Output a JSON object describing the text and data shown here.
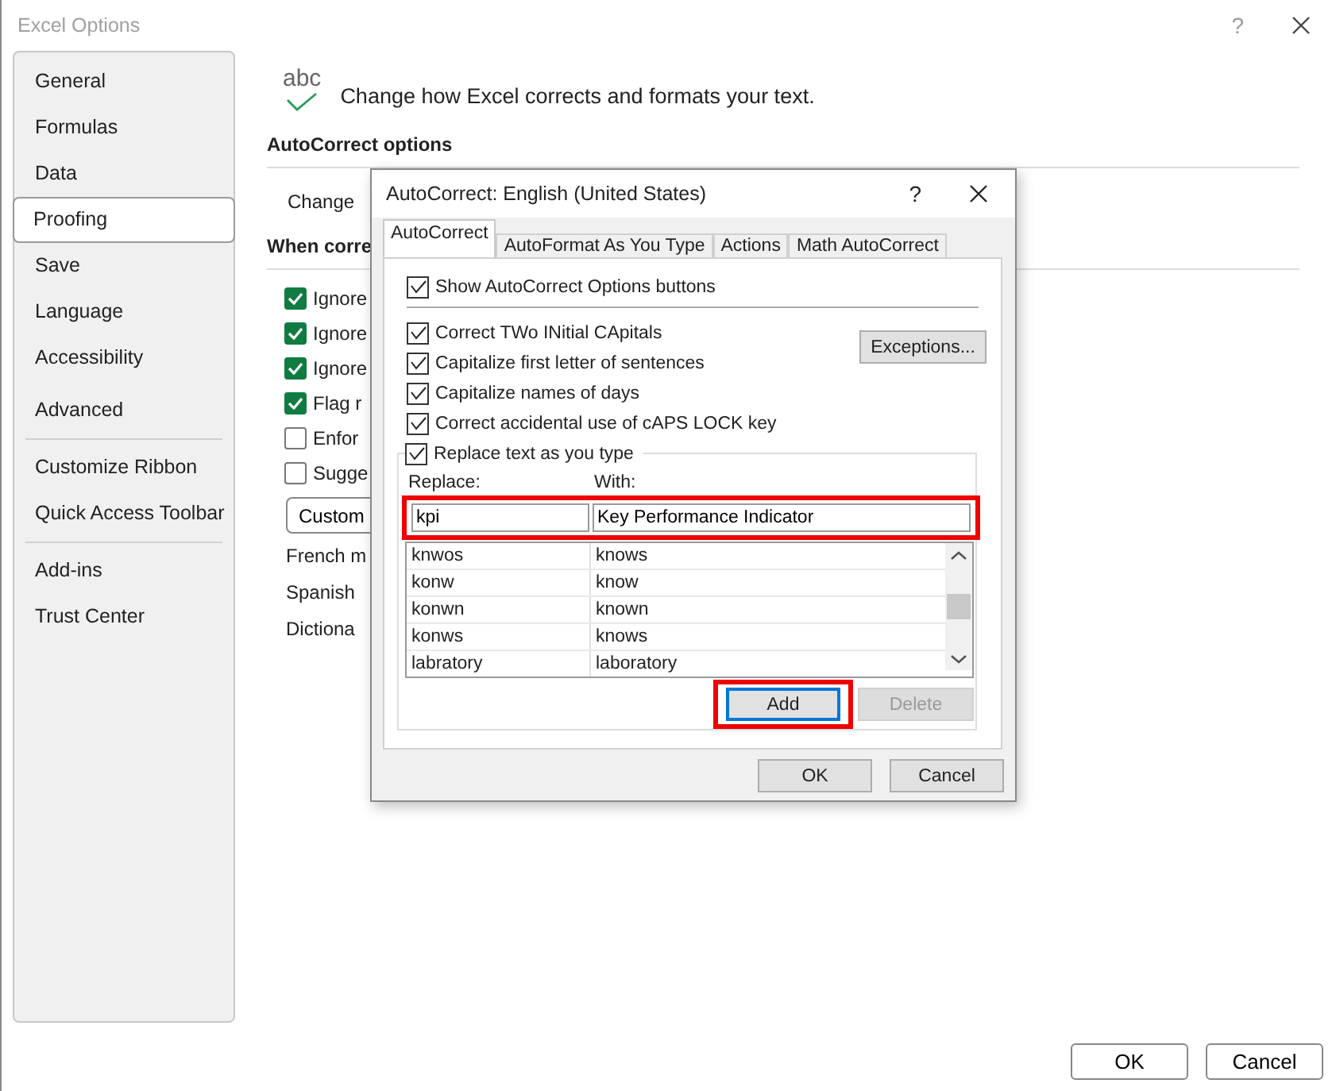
{
  "window": {
    "title": "Excel Options",
    "help": "?"
  },
  "sidebar": {
    "groups": [
      [
        {
          "label": "General",
          "selected": false
        },
        {
          "label": "Formulas",
          "selected": false
        },
        {
          "label": "Data",
          "selected": false
        },
        {
          "label": "Proofing",
          "selected": true
        },
        {
          "label": "Save",
          "selected": false
        },
        {
          "label": "Language",
          "selected": false
        },
        {
          "label": "Accessibility",
          "selected": false
        },
        {
          "label": "Advanced",
          "selected": false
        }
      ],
      [
        {
          "label": "Customize Ribbon",
          "selected": false
        },
        {
          "label": "Quick Access Toolbar",
          "selected": false
        }
      ],
      [
        {
          "label": "Add-ins",
          "selected": false
        },
        {
          "label": "Trust Center",
          "selected": false
        }
      ]
    ]
  },
  "main": {
    "icon_label": "abc",
    "intro": "Change how Excel corrects and formats your text.",
    "autocorrect_heading": "AutoCorrect options",
    "autocorrect_text": "Change",
    "when_heading": "When corre",
    "checks": [
      {
        "label": "Ignore",
        "checked": true
      },
      {
        "label": "Ignore",
        "checked": true
      },
      {
        "label": "Ignore",
        "checked": true
      },
      {
        "label": "Flag r",
        "checked": true
      },
      {
        "label": "Enfor",
        "checked": false
      },
      {
        "label": "Sugge",
        "checked": false
      }
    ],
    "custom_button": "Custom",
    "lines": [
      "French m",
      "Spanish",
      "Dictiona"
    ]
  },
  "dialog": {
    "title": "AutoCorrect: English (United States)",
    "help": "?",
    "tabs": [
      {
        "label": "AutoCorrect",
        "selected": true
      },
      {
        "label": "AutoFormat As You Type",
        "selected": false
      },
      {
        "label": "Actions",
        "selected": false
      },
      {
        "label": "Math AutoCorrect",
        "selected": false
      }
    ],
    "show_option": {
      "label": "Show AutoCorrect Options buttons",
      "checked": true
    },
    "options": [
      {
        "label": "Correct TWo INitial CApitals",
        "checked": true
      },
      {
        "label": "Capitalize first letter of sentences",
        "checked": true
      },
      {
        "label": "Capitalize names of days",
        "checked": true
      },
      {
        "label": "Correct accidental use of cAPS LOCK key",
        "checked": true
      }
    ],
    "exceptions_button": "Exceptions...",
    "replace_option": {
      "label": "Replace text as you type",
      "checked": true
    },
    "replace_label": "Replace:",
    "with_label": "With:",
    "entry": {
      "replace": "kpi",
      "with": "Key Performance Indicator",
      "highlighted": true
    },
    "rows": [
      {
        "replace": "knwos",
        "with": "knows"
      },
      {
        "replace": "konw",
        "with": "know"
      },
      {
        "replace": "konwn",
        "with": "known"
      },
      {
        "replace": "konws",
        "with": "knows"
      },
      {
        "replace": "labratory",
        "with": "laboratory"
      }
    ],
    "add_button": {
      "label": "Add",
      "highlighted": true,
      "disabled": false
    },
    "delete_button": {
      "label": "Delete",
      "disabled": true
    },
    "ok": "OK",
    "cancel": "Cancel"
  },
  "footer": {
    "ok": "OK",
    "cancel": "Cancel"
  }
}
